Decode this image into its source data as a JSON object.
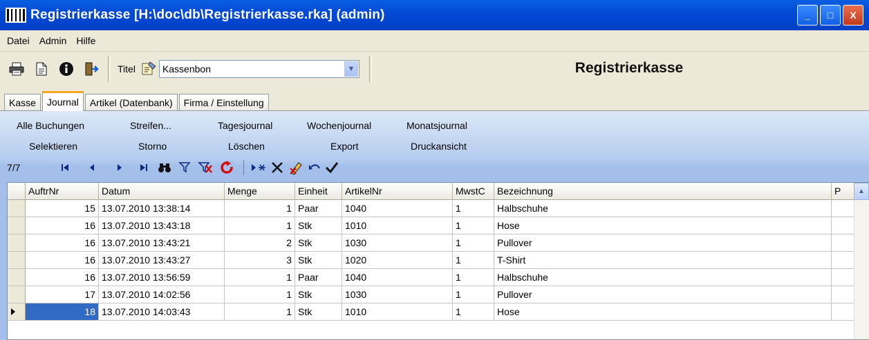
{
  "window": {
    "title": "Registrierkasse [H:\\doc\\db\\Registrierkasse.rka] (admin)",
    "buttons": [
      "_",
      "□",
      "X"
    ]
  },
  "menu": [
    "Datei",
    "Admin",
    "Hilfe"
  ],
  "toolbar": {
    "icons": [
      "printer-icon",
      "document-icon",
      "info-icon",
      "exit-icon"
    ],
    "titel_label": "Titel",
    "titel_value": "Kassenbon",
    "app_name": "Registrierkasse"
  },
  "tabs": [
    "Kasse",
    "Journal",
    "Artikel (Datenbank)",
    "Firma / Einstellung"
  ],
  "active_tab": "Journal",
  "commands": {
    "row1": [
      "Alle Buchungen",
      "Streifen...",
      "Tagesjournal",
      "Wochenjournal",
      "Monatsjournal"
    ],
    "row2": [
      "Selektieren",
      "Storno",
      "Löschen",
      "Export",
      "Druckansicht"
    ]
  },
  "navigator": {
    "count": "7/7"
  },
  "grid": {
    "columns": [
      "AuftrNr",
      "Datum",
      "Menge",
      "Einheit",
      "ArtikelNr",
      "MwstC",
      "Bezeichnung",
      "P"
    ],
    "rows": [
      {
        "auftrnr": "15",
        "datum": "13.07.2010 13:38:14",
        "menge": "1",
        "einheit": "Paar",
        "artikelnr": "1040",
        "mwstc": "1",
        "bezeichnung": "Halbschuhe"
      },
      {
        "auftrnr": "16",
        "datum": "13.07.2010 13:43:18",
        "menge": "1",
        "einheit": "Stk",
        "artikelnr": "1010",
        "mwstc": "1",
        "bezeichnung": "Hose"
      },
      {
        "auftrnr": "16",
        "datum": "13.07.2010 13:43:21",
        "menge": "2",
        "einheit": "Stk",
        "artikelnr": "1030",
        "mwstc": "1",
        "bezeichnung": "Pullover"
      },
      {
        "auftrnr": "16",
        "datum": "13.07.2010 13:43:27",
        "menge": "3",
        "einheit": "Stk",
        "artikelnr": "1020",
        "mwstc": "1",
        "bezeichnung": "T-Shirt"
      },
      {
        "auftrnr": "16",
        "datum": "13.07.2010 13:56:59",
        "menge": "1",
        "einheit": "Paar",
        "artikelnr": "1040",
        "mwstc": "1",
        "bezeichnung": "Halbschuhe"
      },
      {
        "auftrnr": "17",
        "datum": "13.07.2010 14:02:56",
        "menge": "1",
        "einheit": "Stk",
        "artikelnr": "1030",
        "mwstc": "1",
        "bezeichnung": "Pullover"
      },
      {
        "auftrnr": "18",
        "datum": "13.07.2010 14:03:43",
        "menge": "1",
        "einheit": "Stk",
        "artikelnr": "1010",
        "mwstc": "1",
        "bezeichnung": "Hose"
      }
    ],
    "current_row": 6
  },
  "colors": {
    "titlebar": "#0349d6",
    "selection": "#316ac5",
    "active_tab_accent": "#f6a621"
  }
}
